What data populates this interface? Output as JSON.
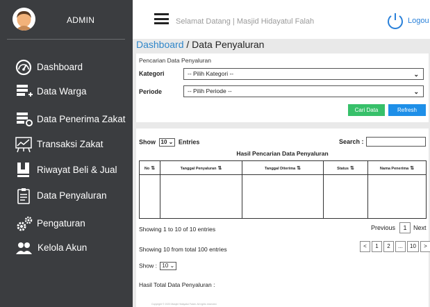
{
  "sidebar": {
    "user": "ADMIN",
    "items": [
      {
        "label": "Dashboard",
        "icon": "dashboard-gauge-icon"
      },
      {
        "label": "Data Warga",
        "icon": "database-add-icon"
      },
      {
        "label": "Data Penerima Zakat",
        "icon": "database-search-icon"
      },
      {
        "label": "Transaksi Zakat",
        "icon": "chart-board-icon"
      },
      {
        "label": "Riwayat Beli & Jual",
        "icon": "book-icon"
      },
      {
        "label": "Data Penyaluran",
        "icon": "clipboard-icon"
      },
      {
        "label": "Pengaturan",
        "icon": "gears-icon"
      },
      {
        "label": "Kelola Akun",
        "icon": "users-icon"
      }
    ]
  },
  "header": {
    "welcome": "Selamat Datang | Masjid Hidayatul Falah",
    "logout": "Logou"
  },
  "breadcrumb": {
    "link": "Dashboard",
    "separator": " / ",
    "current": "Data Penyaluran"
  },
  "search_panel": {
    "title": "Pencarian Data Penyaluran",
    "kategori_label": "Kategori",
    "kategori_value": "-- Pilih Kategori --",
    "periode_label": "Periode",
    "periode_value": "-- Pilih Periode --",
    "cari_button": "Cari Data",
    "refresh_button": "Refresh"
  },
  "table_panel": {
    "show_label": "Show",
    "show_value": "10",
    "entries_label": "Entries",
    "search_label": "Search :",
    "search_value": "",
    "result_title": "Hasil Pencarian Data Penyaluran",
    "columns": [
      "No",
      "Tanggal Penyaluran",
      "Tanggal Diterima",
      "Status",
      "Nama Penerima"
    ],
    "showing_text": "Showing 1 to 10 of 10 entries",
    "prev_label": "Previous",
    "current_page": "1",
    "next_label": "Next",
    "showing_total": "Showing 10 from total 100 entries",
    "pages": [
      "<",
      "1",
      "2",
      "...",
      "10",
      ">"
    ],
    "show_small_label": "Show :",
    "show_small_value": "10",
    "total_label": "Hasil Total Data Penyaluran :",
    "footer": "Copyright © 2023 Masjid Hidayatul Falah. All rights reserved."
  },
  "colors": {
    "sidebar_bg": "#3b3d40",
    "link_blue": "#2f86c9",
    "btn_green": "#37c06a",
    "btn_blue": "#1e8fe8"
  }
}
